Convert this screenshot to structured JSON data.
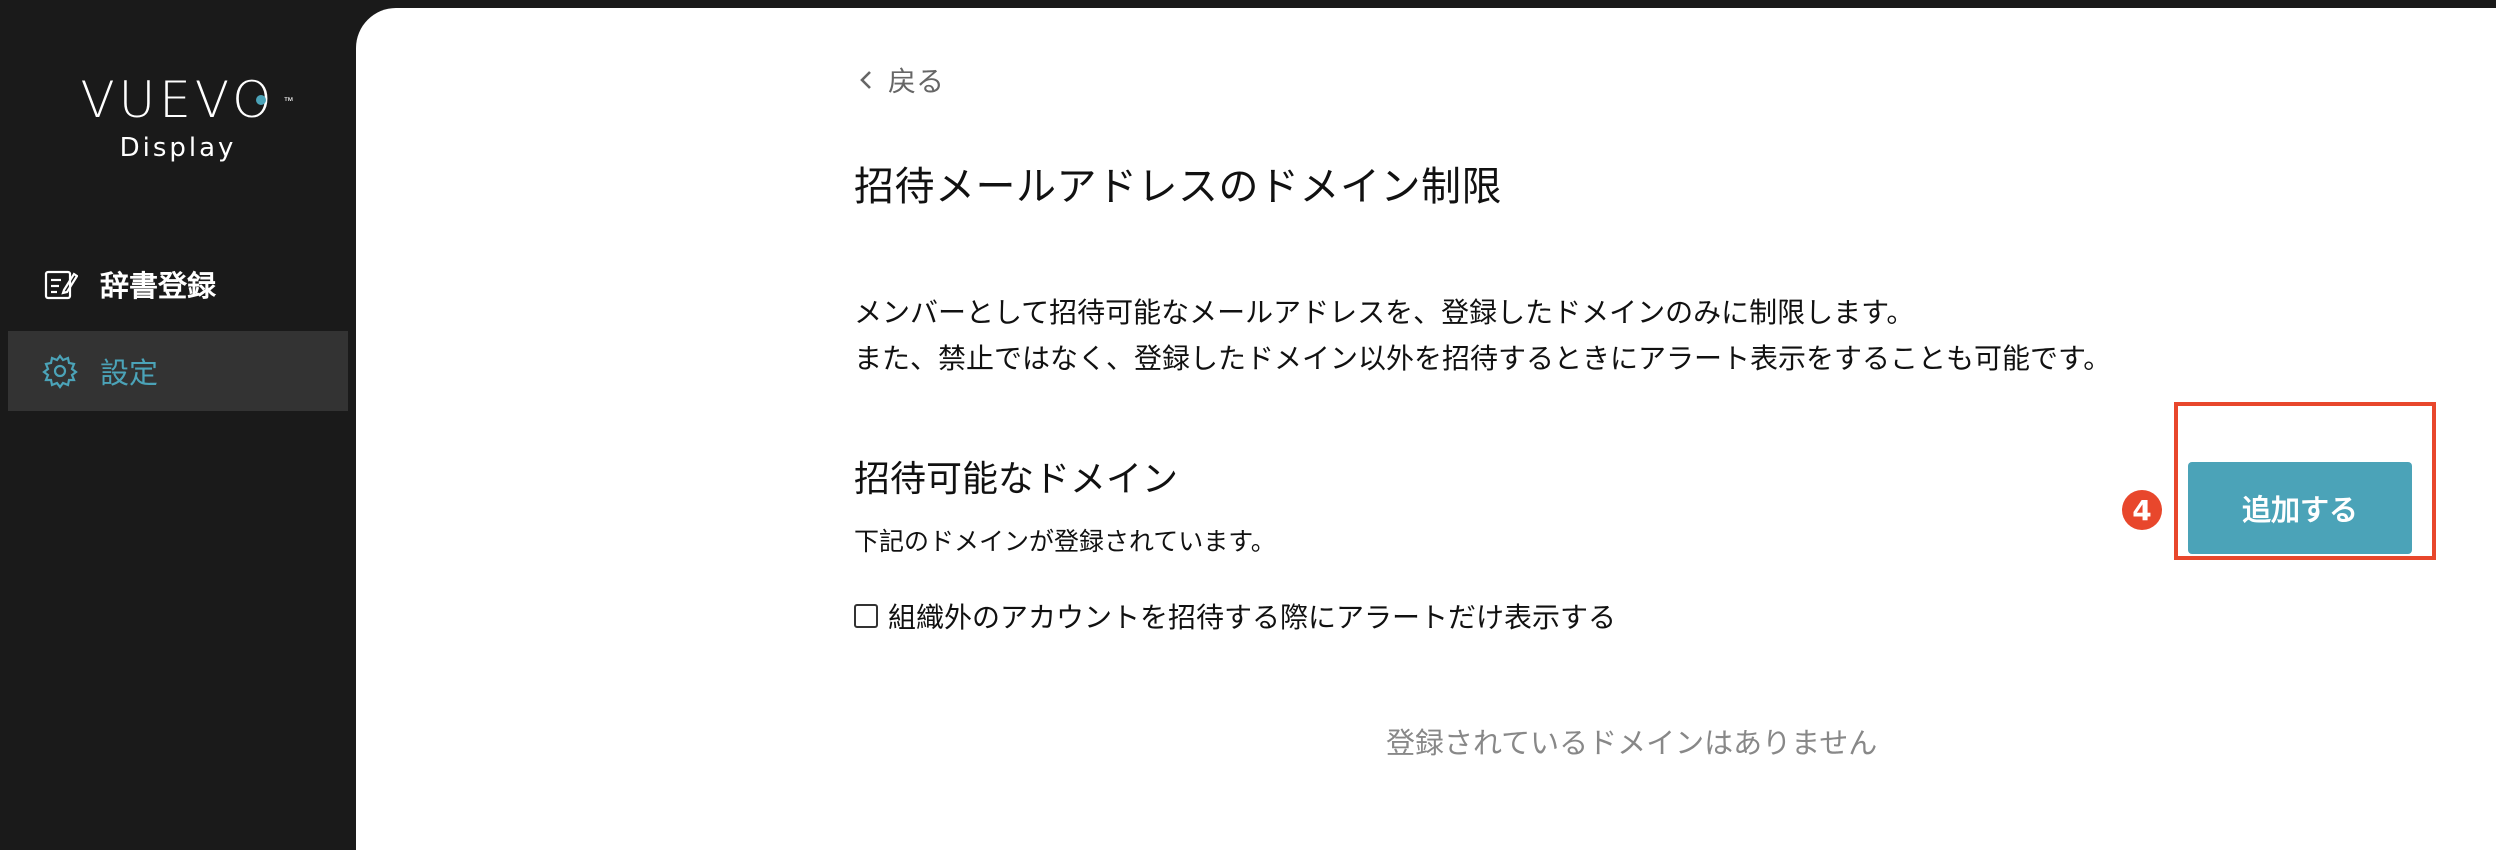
{
  "brand": {
    "logo_main": "VUEVO",
    "logo_tm": "™",
    "logo_sub": "Display",
    "accent_color": "#4ba3b8"
  },
  "sidebar": {
    "items": [
      {
        "label": "辞書登録",
        "icon": "dictionary-edit-icon",
        "active": false
      },
      {
        "label": "設定",
        "icon": "gear-icon",
        "active": true
      }
    ]
  },
  "main": {
    "back_label": "戻る",
    "title": "招待メールアドレスのドメイン制限",
    "description_line1": "メンバーとして招待可能なメールアドレスを、登録したドメインのみに制限します。",
    "description_line2": "また、禁止ではなく、登録したドメイン以外を招待するときにアラート表示をすることも可能です。",
    "section_title": "招待可能なドメイン",
    "section_sub": "下記のドメインが登録されています。",
    "checkbox_label": "組織外のアカウントを招待する際にアラートだけ表示する",
    "checkbox_checked": false,
    "empty_message": "登録されているドメインはありません",
    "add_button_label": "追加する",
    "step_badge": "4",
    "highlight_color": "#e8472c"
  }
}
